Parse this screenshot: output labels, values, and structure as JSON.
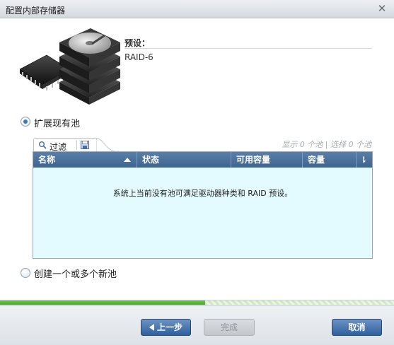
{
  "window": {
    "title": "配置内部存储器",
    "close_glyph": "✕"
  },
  "preset": {
    "label": "预设：",
    "value": "RAID-6"
  },
  "options": {
    "expand_existing": {
      "label": "扩展现有池",
      "checked": true
    },
    "create_new": {
      "label": "创建一个或多个新池",
      "checked": false
    }
  },
  "toolbar": {
    "filter_label": "过滤",
    "counts": "显示 0 个池 | 选择 0 个池"
  },
  "table": {
    "columns": [
      "名称",
      "状态",
      "可用容量",
      "容量",
      "⇂"
    ],
    "sorted_column": "名称",
    "empty_message": "系统上当前没有池可满足驱动器种类和 RAID 预设。"
  },
  "progress": {
    "fraction": 0.52
  },
  "footer": {
    "back_label": "上一步",
    "finish_label": "完成",
    "cancel_label": "取消"
  },
  "colors": {
    "header": "#3e6591",
    "grid_bg": "#e3fbff",
    "progress": "#45a32a",
    "accent": "#2f5f9c"
  },
  "icons": [
    "close-icon",
    "storage-drives-icon",
    "search-icon",
    "save-icon",
    "sort-up-icon",
    "column-chooser-icon",
    "back-arrow-icon"
  ]
}
